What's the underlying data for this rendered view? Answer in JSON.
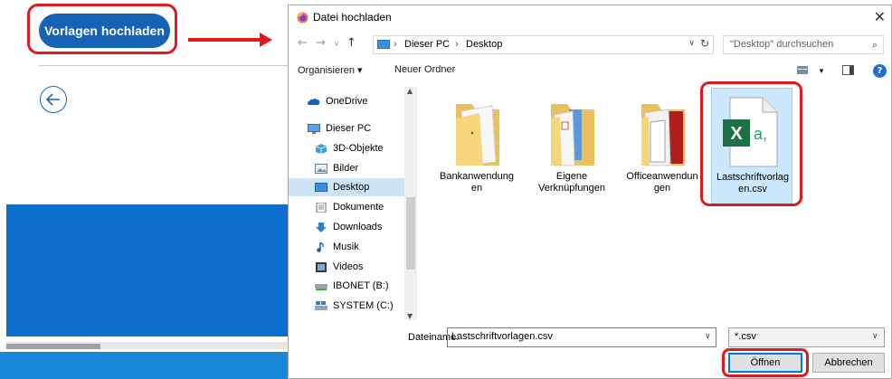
{
  "page": {
    "upload_button_label": "Vorlagen hochladen"
  },
  "dialog": {
    "title": "Datei hochladen",
    "address": {
      "crumbs": [
        "Dieser PC",
        "Desktop"
      ],
      "search_placeholder": "\"Desktop\" durchsuchen"
    },
    "toolbar": {
      "organize_label": "Organisieren ▾",
      "new_folder_label": "Neuer Ordner"
    },
    "nav_items": [
      {
        "label": "OneDrive",
        "icon": "onedrive-icon"
      },
      {
        "label": "Dieser PC",
        "icon": "pc-icon"
      },
      {
        "label": "3D-Objekte",
        "icon": "3d-objects-icon"
      },
      {
        "label": "Bilder",
        "icon": "pictures-icon"
      },
      {
        "label": "Desktop",
        "icon": "desktop-icon",
        "selected": true
      },
      {
        "label": "Dokumente",
        "icon": "documents-icon"
      },
      {
        "label": "Downloads",
        "icon": "downloads-icon"
      },
      {
        "label": "Musik",
        "icon": "music-icon"
      },
      {
        "label": "Videos",
        "icon": "videos-icon"
      },
      {
        "label": "IBONET (B:)",
        "icon": "network-drive-icon"
      },
      {
        "label": "SYSTEM (C:)",
        "icon": "system-drive-icon"
      }
    ],
    "files": [
      {
        "label_line1": "Bankanwendung",
        "label_line2": "en",
        "icon": "folder-icon"
      },
      {
        "label_line1": "Eigene",
        "label_line2": "Verknüpfungen",
        "icon": "folder-icon"
      },
      {
        "label_line1": "Officeanwendun",
        "label_line2": "gen",
        "icon": "folder-icon"
      },
      {
        "label_line1": "Lastschriftvorlag",
        "label_line2": "en.csv",
        "icon": "excel-csv-icon",
        "selected": true
      }
    ],
    "filename_label": "Dateiname:",
    "filename_value": "Lastschriftvorlagen.csv",
    "filetype_value": "*.csv",
    "open_label": "Öffnen",
    "cancel_label": "Abbrechen"
  },
  "colors": {
    "accent_blue": "#1563b5",
    "callout_red": "#e0191f",
    "selection_blue": "#cce8ff",
    "excel_green": "#1e7145"
  }
}
